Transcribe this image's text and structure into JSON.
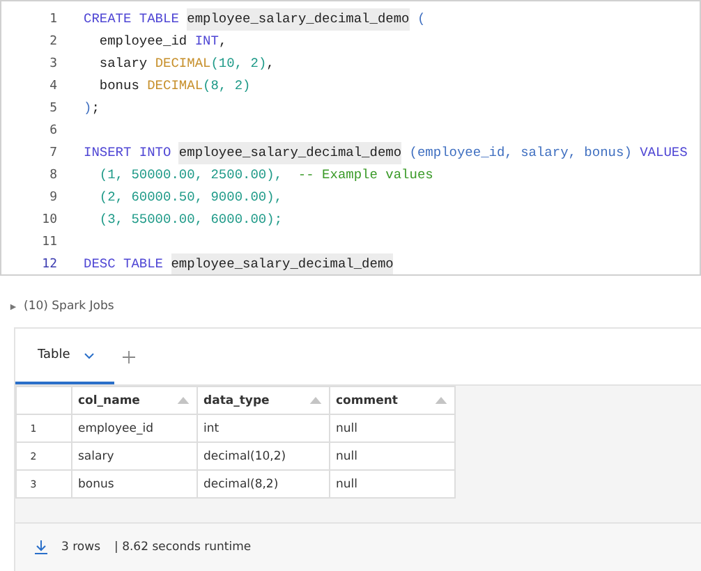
{
  "editor": {
    "lines": [
      {
        "number": "1",
        "active": false,
        "tokens": [
          {
            "text": "CREATE TABLE ",
            "kind": "keyword"
          },
          {
            "text": "employee_salary_decimal_demo",
            "kind": "table"
          },
          {
            "text": " (",
            "kind": "punctuation"
          }
        ]
      },
      {
        "number": "2",
        "active": false,
        "tokens": [
          {
            "text": "  employee_id ",
            "kind": "identifier"
          },
          {
            "text": "INT",
            "kind": "keyword"
          },
          {
            "text": ",",
            "kind": "identifier"
          }
        ]
      },
      {
        "number": "3",
        "active": false,
        "tokens": [
          {
            "text": "  salary ",
            "kind": "identifier"
          },
          {
            "text": "DECIMAL",
            "kind": "type"
          },
          {
            "text": "(10, 2)",
            "kind": "number"
          },
          {
            "text": ",",
            "kind": "identifier"
          }
        ]
      },
      {
        "number": "4",
        "active": false,
        "tokens": [
          {
            "text": "  bonus ",
            "kind": "identifier"
          },
          {
            "text": "DECIMAL",
            "kind": "type"
          },
          {
            "text": "(8, 2)",
            "kind": "number"
          }
        ]
      },
      {
        "number": "5",
        "active": false,
        "tokens": [
          {
            "text": ")",
            "kind": "punctuation"
          },
          {
            "text": ";",
            "kind": "identifier"
          }
        ]
      },
      {
        "number": "6",
        "active": false
      },
      {
        "number": "7",
        "active": false,
        "tokens": [
          {
            "text": "INSERT INTO ",
            "kind": "keyword"
          },
          {
            "text": "employee_salary_decimal_demo",
            "kind": "table"
          },
          {
            "text": " (employee_id, salary, bonus) ",
            "kind": "punctuation"
          },
          {
            "text": "VALUES",
            "kind": "keyword"
          }
        ]
      },
      {
        "number": "8",
        "active": false,
        "tokens": [
          {
            "text": "  (1, 50000.00, 2500.00),",
            "kind": "number"
          },
          {
            "text": "  -- Example values",
            "kind": "comment"
          }
        ]
      },
      {
        "number": "9",
        "active": false,
        "tokens": [
          {
            "text": "  (2, 60000.50, 9000.00),",
            "kind": "number"
          }
        ]
      },
      {
        "number": "10",
        "active": false,
        "tokens": [
          {
            "text": "  (3, 55000.00, 6000.00);",
            "kind": "number"
          }
        ]
      },
      {
        "number": "11",
        "active": false
      },
      {
        "number": "12",
        "active": true,
        "tokens": [
          {
            "text": "DESC TABLE ",
            "kind": "keyword"
          },
          {
            "text": "employee_salary_decimal_demo",
            "kind": "table"
          }
        ]
      }
    ]
  },
  "spark_jobs": {
    "label": "(10) Spark Jobs",
    "expanded": false
  },
  "tabs": [
    {
      "label": "Table",
      "selected": true
    }
  ],
  "table": {
    "columns": [
      "col_name",
      "data_type",
      "comment"
    ],
    "rows": [
      {
        "index": "1",
        "cells": [
          "employee_id",
          "int",
          "null"
        ]
      },
      {
        "index": "2",
        "cells": [
          "salary",
          "decimal(10,2)",
          "null"
        ]
      },
      {
        "index": "3",
        "cells": [
          "bonus",
          "decimal(8,2)",
          "null"
        ]
      }
    ]
  },
  "footer": {
    "rows": "3 rows",
    "runtime": "| 8.62 seconds runtime"
  }
}
